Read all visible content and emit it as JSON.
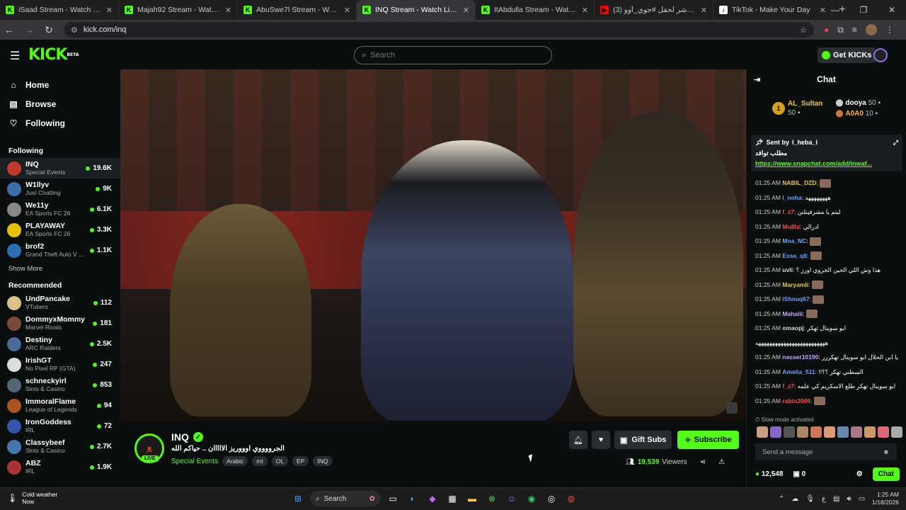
{
  "browser": {
    "tabs": [
      {
        "title": "iSaad Stream - Watch Live on K",
        "icon": "kick-icon",
        "active": false
      },
      {
        "title": "Majah92 Stream - Watch Live o",
        "icon": "kick-icon",
        "active": false
      },
      {
        "title": "AbuSwe7l Stream - Watch Live",
        "icon": "kick-icon",
        "active": false
      },
      {
        "title": "INQ Stream - Watch Live on Ki",
        "icon": "kick-icon",
        "active": true
      },
      {
        "title": "ItAbdulla Stream - Watch Live",
        "icon": "kick-icon",
        "active": false
      },
      {
        "title": "(3) البث المباشر لحفل #جوي_أوو",
        "icon": "youtube-icon",
        "active": false
      },
      {
        "title": "TikTok - Make Your Day",
        "icon": "tiktok-icon",
        "active": false
      }
    ],
    "url": "kick.com/inq"
  },
  "site": {
    "logo": "KICK",
    "logo_badge": "BETA",
    "search_placeholder": "Search",
    "get_kicks_label": "Get KICKs"
  },
  "sidebar": {
    "nav": [
      {
        "label": "Home",
        "icon": "home-icon"
      },
      {
        "label": "Browse",
        "icon": "browse-icon"
      },
      {
        "label": "Following",
        "icon": "heart-icon"
      }
    ],
    "following_title": "Following",
    "following": [
      {
        "name": "INQ",
        "category": "Special Events",
        "viewers": "19.6K",
        "color": "#c0392b"
      },
      {
        "name": "W1llyv",
        "category": "Just Chatting",
        "viewers": "9K",
        "color": "#3b6ea8"
      },
      {
        "name": "We11y",
        "category": "EA Sports FC 26",
        "viewers": "6.1K",
        "color": "#888888"
      },
      {
        "name": "PLAYAWAY",
        "category": "EA Sports FC 26",
        "viewers": "3.3K",
        "color": "#e5c100"
      },
      {
        "name": "brof2",
        "category": "Grand Theft Auto V (G...",
        "viewers": "1.1K",
        "color": "#2a6fb0"
      }
    ],
    "show_more": "Show More",
    "recommended_title": "Recommended",
    "recommended": [
      {
        "name": "UndPancake",
        "category": "VTubers",
        "viewers": "112",
        "color": "#d9c38a"
      },
      {
        "name": "DommyxMommy",
        "category": "Marvel Rivals",
        "viewers": "181",
        "color": "#7a4a3a"
      },
      {
        "name": "Destiny",
        "category": "ARC Raiders",
        "viewers": "2.5K",
        "color": "#4a6a9a"
      },
      {
        "name": "IrishGT",
        "category": "No Pixel RP (GTA)",
        "viewers": "247",
        "color": "#dddddd"
      },
      {
        "name": "schneckyirl",
        "category": "Slots & Casino",
        "viewers": "853",
        "color": "#556677"
      },
      {
        "name": "ImmoralFlame",
        "category": "League of Legends",
        "viewers": "94",
        "color": "#aa5522"
      },
      {
        "name": "IronGoddess",
        "category": "IRL",
        "viewers": "72",
        "color": "#3355aa"
      },
      {
        "name": "Classybeef",
        "category": "Slots & Casino",
        "viewers": "2.7K",
        "color": "#4477aa"
      },
      {
        "name": "ABZ",
        "category": "IRL",
        "viewers": "1.9K",
        "color": "#aa3333"
      }
    ]
  },
  "stream": {
    "channel": "INQ",
    "live_badge": "LIVE",
    "title": "الجرووووي اوووريز الااااان .. حياكم الله",
    "category": "Special Events",
    "tags": [
      "Arabic",
      "mt",
      "OL",
      "EP",
      "INQ"
    ],
    "gift_subs_label": "Gift Subs",
    "subscribe_label": "Subscribe",
    "viewers": "19,539",
    "viewers_label": "Viewers"
  },
  "chat": {
    "title": "Chat",
    "leaderboard": [
      {
        "rank": "1",
        "name": "AL_Sultan",
        "amount": "50"
      },
      {
        "name": "dooya",
        "amount": "50"
      },
      {
        "name": "A0A0",
        "amount": "10"
      }
    ],
    "pinned": {
      "sent_by_label": "Sent by",
      "sender": "l_heba_l",
      "text": "مطلب توافد",
      "link": "https://www.snapchat.com/add/inwaf..."
    },
    "messages": [
      {
        "time": "01:25 AM",
        "user": "NABIL_DZD",
        "color": "#e7c64b",
        "text": ""
      },
      {
        "time": "01:25 AM",
        "user": "l_noha",
        "color": "#6fa0ff",
        "text": "ههههههههه"
      },
      {
        "time": "01:25 AM",
        "user": "f_z7",
        "color": "#ff4a4a",
        "text": "ليتم يا مشرفينلنن"
      },
      {
        "time": "01:25 AM",
        "user": "Mo8hi",
        "color": "#ff4a4a",
        "text": "ادرالي"
      },
      {
        "time": "01:25 AM",
        "user": "Mna_NC",
        "color": "#6fa0ff",
        "text": ""
      },
      {
        "time": "01:25 AM",
        "user": "Essa_q8",
        "color": "#6fa0ff",
        "text": ""
      },
      {
        "time": "01:25 AM",
        "user": "uvli",
        "color": "#dddddd",
        "text": "هذا وش اللي الحين الجروي اورز ؟"
      },
      {
        "time": "01:25 AM",
        "user": "Maryamli",
        "color": "#e7c64b",
        "text": ""
      },
      {
        "time": "01:25 AM",
        "user": "iShouq67",
        "color": "#6fa0ff",
        "text": ""
      },
      {
        "time": "01:25 AM",
        "user": "Mahaiii",
        "color": "#c9a6ff",
        "text": ""
      },
      {
        "time": "01:25 AM",
        "user": "omaopj",
        "color": "#dddddd",
        "text": "ابو سوينال ثهكر"
      },
      {
        "time": "",
        "user": "",
        "color": "#dddddd",
        "text": "هههههههههههههههههههههههههه"
      },
      {
        "time": "01:25 AM",
        "user": "nasser10190",
        "color": "#c9a6ff",
        "text": "يا ابن الحلال ابو سوينال تهكررر"
      },
      {
        "time": "01:25 AM",
        "user": "Amelia_511",
        "color": "#6fa0ff",
        "text": "السطني تهكر ؟؟!!"
      },
      {
        "time": "01:25 AM",
        "user": "f_z7",
        "color": "#ff4a4a",
        "text": "ابو سوينال تهكر طلع الاسكريم كي علمه"
      },
      {
        "time": "01:25 AM",
        "user": "rabin2006",
        "color": "#ff4a4a",
        "text": ""
      }
    ],
    "slow_mode": "Slow mode activated",
    "input_placeholder": "Send a message",
    "kicks_count": "12,548",
    "gifts_count": "0",
    "send_label": "Chat"
  },
  "taskbar": {
    "weather_title": "Cold weather",
    "weather_sub": "Now",
    "search_label": "Search",
    "time": "1:25 AM",
    "date": "1/18/2026"
  }
}
